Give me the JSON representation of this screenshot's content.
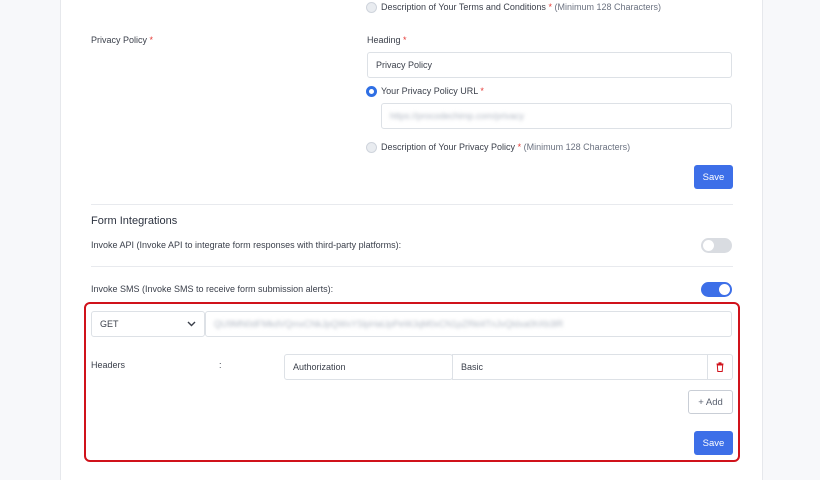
{
  "terms": {
    "description_option_label": "Description of Your Terms and Conditions",
    "description_option_hint": "(Minimum 128 Characters)"
  },
  "privacy": {
    "section_label": "Privacy Policy",
    "heading_label": "Heading",
    "heading_value": "Privacy Policy",
    "url_option_label": "Your Privacy Policy URL",
    "url_value": "https://procodechimp.com/privacy",
    "description_option_label": "Description of Your Privacy Policy",
    "description_option_hint": "(Minimum 128 Characters)",
    "save_label": "Save"
  },
  "integrations": {
    "title": "Form Integrations",
    "invoke_api_label": "Invoke API (Invoke API to integrate form responses with third-party platforms):",
    "invoke_api_enabled": false,
    "invoke_sms_label": "Invoke SMS (Invoke SMS to receive form submission alerts):",
    "invoke_sms_enabled": true
  },
  "sms": {
    "method_value": "GET",
    "endpoint_value": "QU9MN0dFMkdVQmxCNkJpQWxYSlpHaUpPeWJqM0xCN1pZRkl4TnJvQldxa0hXb3lR",
    "headers_label": "Headers",
    "headers_separator": ":",
    "header_key": "Authorization",
    "header_value": "Basic",
    "add_label": "+ Add",
    "save_label": "Save"
  },
  "colors": {
    "accent": "#3d6fe8",
    "highlight_border": "#d0121b",
    "required": "#e53935"
  },
  "icons": {
    "chevron": "chevron-down-icon",
    "delete": "trash-icon"
  }
}
